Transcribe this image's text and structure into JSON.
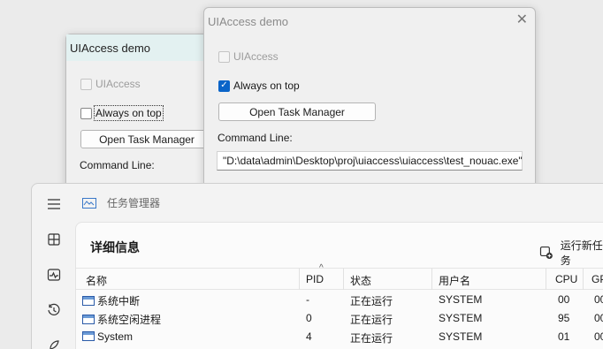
{
  "back_window": {
    "title": "UIAccess demo",
    "uiaccess_label": "UIAccess",
    "always_on_top_label": "Always on top",
    "open_tm_label": "Open Task Manager",
    "cmd_label": "Command Line:"
  },
  "front_window": {
    "title": "UIAccess demo",
    "uiaccess_label": "UIAccess",
    "always_on_top_label": "Always on top",
    "open_tm_label": "Open Task Manager",
    "cmd_label": "Command Line:",
    "cmd_value": "\"D:\\data\\admin\\Desktop\\proj\\uiaccess\\uiaccess\\test_nouac.exe\""
  },
  "task_manager": {
    "app_title": "任务管理器",
    "page_title": "详细信息",
    "run_new_task": "运行新任务",
    "columns": {
      "name": "名称",
      "pid": "PID",
      "status": "状态",
      "user": "用户名",
      "cpu": "CPU",
      "gpu": "GP"
    },
    "rows": [
      {
        "name": "系统中断",
        "pid": "-",
        "status": "正在运行",
        "user": "SYSTEM",
        "cpu": "00",
        "gpu": "00"
      },
      {
        "name": "系统空闲进程",
        "pid": "0",
        "status": "正在运行",
        "user": "SYSTEM",
        "cpu": "95",
        "gpu": "00"
      },
      {
        "name": "System",
        "pid": "4",
        "status": "正在运行",
        "user": "SYSTEM",
        "cpu": "01",
        "gpu": "00"
      }
    ]
  }
}
